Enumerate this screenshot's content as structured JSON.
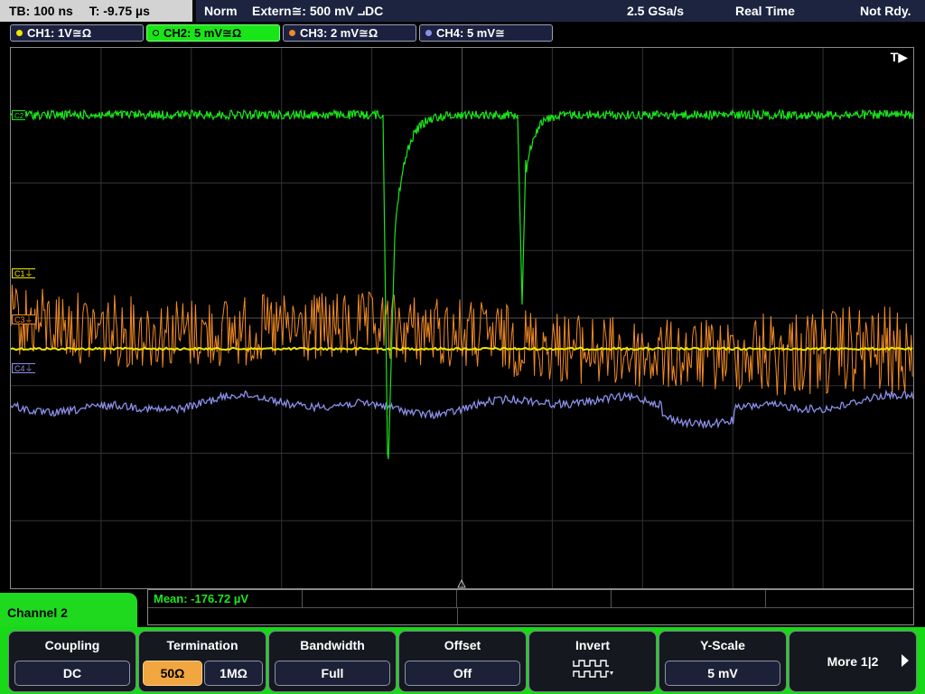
{
  "status": {
    "timebase": "TB: 100 ns",
    "trigger_time": "T: -9.75 µs",
    "mode": "Norm",
    "trigger_source": "Extern≅: 500 mV ⨼DC",
    "sample_rate": "2.5 GSa/s",
    "acq_mode": "Real Time",
    "ready_state": "Not Rdy."
  },
  "channels": [
    {
      "label": "CH1: 1V≅Ω",
      "color": "#f2e600",
      "active": false
    },
    {
      "label": "CH2: 5 mV≅Ω",
      "color": "#19e619",
      "active": true
    },
    {
      "label": "CH3: 2 mV≅Ω",
      "color": "#f08a24",
      "active": false
    },
    {
      "label": "CH4: 5 mV≅",
      "color": "#8a8fe8",
      "active": false
    }
  ],
  "plot": {
    "trigger_marker": "T▶",
    "markers": [
      {
        "text": "C1⏚",
        "color": "#f2e600"
      },
      {
        "text": "C3⏚",
        "color": "#f08a24"
      },
      {
        "text": "C4⏚",
        "color": "#8a8fe8"
      }
    ],
    "ch2_marker": "C2"
  },
  "measurement": {
    "text": "Mean: -176.72 µV"
  },
  "menu": {
    "channel_label": "Channel 2",
    "coupling": {
      "title": "Coupling",
      "value": "DC"
    },
    "termination": {
      "title": "Termination",
      "opt1": "50Ω",
      "opt2": "1MΩ"
    },
    "bandwidth": {
      "title": "Bandwidth",
      "value": "Full"
    },
    "offset": {
      "title": "Offset",
      "value": "Off"
    },
    "invert": {
      "title": "Invert",
      "icon": "invert-waveform-icon"
    },
    "yscale": {
      "title": "Y-Scale",
      "value": "5 mV"
    },
    "more": {
      "label": "More 1|2"
    }
  }
}
